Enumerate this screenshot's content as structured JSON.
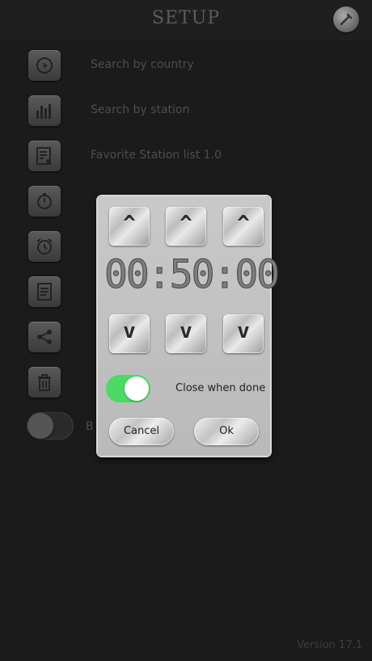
{
  "header": {
    "title": "SETUP",
    "settings_icon": "wrench-icon"
  },
  "menu": {
    "items": [
      {
        "label": "Search by country",
        "icon": "globe-icon"
      },
      {
        "label": "Search by station",
        "icon": "equalizer-icon"
      },
      {
        "label": "Favorite Station list 1.0",
        "icon": "playlist-icon"
      },
      {
        "label": "",
        "icon": "timer-icon"
      },
      {
        "label": "",
        "icon": "alarm-clock-icon"
      },
      {
        "label": "",
        "icon": "document-icon"
      },
      {
        "label": "",
        "icon": "share-icon"
      },
      {
        "label": "",
        "icon": "trash-icon"
      }
    ],
    "background_toggle_label": "B",
    "background_toggle_on": false
  },
  "footer": {
    "version": "Version 17.1"
  },
  "dialog": {
    "up_label": "^",
    "down_label": "v",
    "time": "00:50:00",
    "close_when_done_label": "Close when done",
    "close_when_done_on": true,
    "cancel_label": "Cancel",
    "ok_label": "Ok"
  },
  "colors": {
    "toggle_on": "#4cd964",
    "background": "#1b1b1b"
  }
}
